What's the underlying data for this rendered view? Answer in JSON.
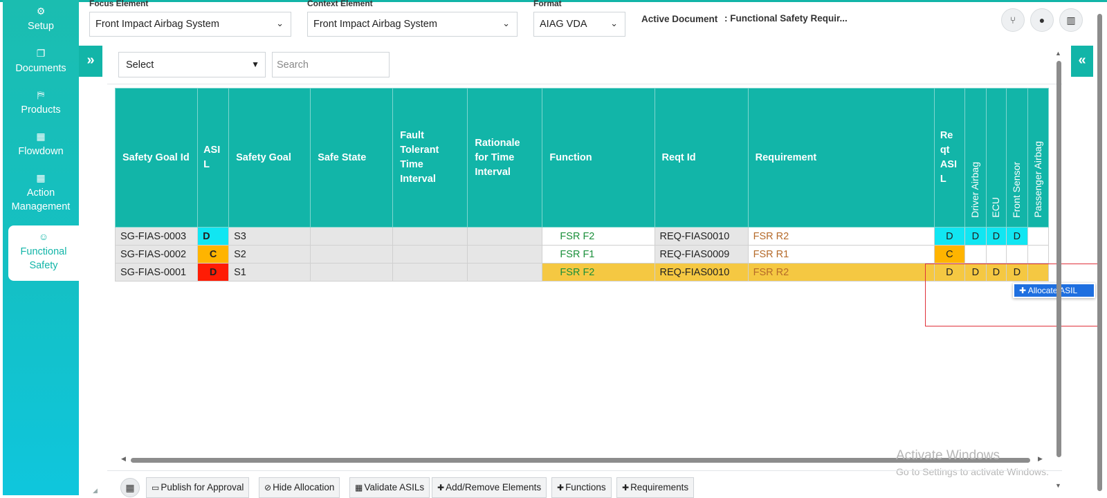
{
  "sidebar": {
    "items": [
      {
        "icon": "gears-icon",
        "glyph": "⚙",
        "label": "Setup"
      },
      {
        "icon": "documents-icon",
        "glyph": "❐",
        "label": "Documents"
      },
      {
        "icon": "products-icon",
        "glyph": "⛿",
        "label": "Products"
      },
      {
        "icon": "flowdown-icon",
        "glyph": "▦",
        "label": "Flowdown"
      },
      {
        "icon": "building-icon",
        "glyph": "▦",
        "label": "Action Management"
      },
      {
        "icon": "functional-safety-icon",
        "glyph": "☺",
        "label": "Functional Safety"
      }
    ]
  },
  "filters": {
    "focus_label": "Focus Element",
    "focus_value": "Front Impact Airbag System",
    "context_label": "Context Element",
    "context_value": "Front Impact Airbag System",
    "format_label": "Format",
    "format_value": "AIAG VDA",
    "active_doc_label": "Active Document",
    "active_doc_value": ": Functional Safety Requir..."
  },
  "toolbar_top": {
    "select_value": "Select",
    "search_placeholder": "Search"
  },
  "table": {
    "headers": [
      "Safety Goal Id",
      "ASI L",
      "Safety Goal",
      "Safe State",
      "Fault Tolerant Time Interval",
      "Rationale for Time Interval",
      "Function",
      "Reqt Id",
      "Requirement",
      "Re qt ASI L"
    ],
    "alloc_headers": [
      "Driver Airbag",
      "ECU",
      "Front Sensor",
      "Passenger Airbag"
    ],
    "rows": [
      {
        "sg_id": "SG-FIAS-0003",
        "asil": "D",
        "goal": "S3",
        "safe_state": "",
        "ftti": "",
        "rationale": "",
        "function": "FSR F2",
        "reqt_id": "REQ-FIAS0010",
        "requirement": "FSR R2",
        "reqt_asil": "D",
        "alloc": [
          "D",
          "D",
          "D",
          ""
        ]
      },
      {
        "sg_id": "SG-FIAS-0002",
        "asil": "C",
        "goal": "S2",
        "safe_state": "",
        "ftti": "",
        "rationale": "",
        "function": "FSR F1",
        "reqt_id": "REQ-FIAS0009",
        "requirement": "FSR R1",
        "reqt_asil": "C",
        "alloc": [
          "",
          "",
          "",
          ""
        ]
      },
      {
        "sg_id": "SG-FIAS-0001",
        "asil": "D",
        "goal": "S1",
        "safe_state": "",
        "ftti": "",
        "rationale": "",
        "function": "FSR F2",
        "reqt_id": "REQ-FIAS0010",
        "requirement": "FSR R2",
        "reqt_asil": "D",
        "alloc": [
          "D",
          "D",
          "D",
          ""
        ]
      }
    ]
  },
  "context_menu": {
    "allocate_label": "Allocate ASIL"
  },
  "watermark": {
    "line1": "Activate Windows",
    "line2": "Go to Settings to activate Windows."
  },
  "bottom_toolbar": {
    "buttons": [
      {
        "label": "Publish for Approval",
        "icon": "publish-icon"
      },
      {
        "label": "Hide Allocation",
        "icon": "eye-slash-icon"
      },
      {
        "label": "Validate ASILs",
        "icon": "building-icon"
      },
      {
        "label": "Add/Remove Elements",
        "icon": "plus-icon"
      },
      {
        "label": "Functions",
        "icon": "plus-icon"
      },
      {
        "label": "Requirements",
        "icon": "plus-icon"
      }
    ]
  },
  "colors": {
    "brand_teal": "#12b5a8",
    "asil_d_cyan": "#11e6f2",
    "asil_c_orange": "#ffb400",
    "asil_d_red": "#ff1c05",
    "row_highlight": "#f5c842",
    "menu_blue": "#1e6fe0"
  }
}
